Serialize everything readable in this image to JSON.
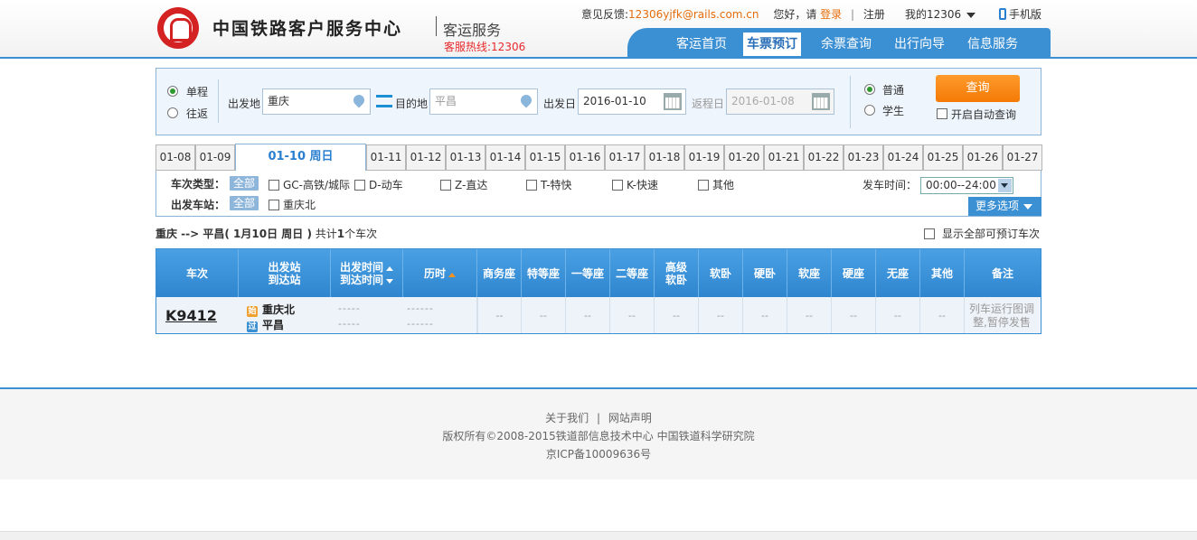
{
  "header": {
    "site_title": "中国铁路客户服务中心",
    "site_subtitle": "客运服务",
    "hotline": "客服热线:12306",
    "feedback_label": "意见反馈:",
    "feedback_email": "12306yjfk@rails.com.cn",
    "greeting": "您好，请",
    "login": "登录",
    "sep": "|",
    "register": "注册",
    "my12306": "我的12306",
    "mobile": "手机版"
  },
  "nav": [
    {
      "label": "客运首页",
      "active": false
    },
    {
      "label": "车票预订",
      "active": true
    },
    {
      "label": "余票查询",
      "active": false
    },
    {
      "label": "出行向导",
      "active": false
    },
    {
      "label": "信息服务",
      "active": false
    }
  ],
  "search": {
    "trip_single": "单程",
    "trip_round": "往返",
    "from_label": "出发地",
    "from_value": "重庆",
    "to_label": "目的地",
    "to_placeholder": "平昌",
    "depart_label": "出发日",
    "depart_value": "2016-01-10",
    "return_label": "返程日",
    "return_value": "2016-01-08",
    "ticket_normal": "普通",
    "ticket_student": "学生",
    "query_button": "查询",
    "auto_query": "开启自动查询"
  },
  "date_tabs": [
    "01-08",
    "01-09",
    "01-10 周日",
    "01-11",
    "01-12",
    "01-13",
    "01-14",
    "01-15",
    "01-16",
    "01-17",
    "01-18",
    "01-19",
    "01-20",
    "01-21",
    "01-22",
    "01-23",
    "01-24",
    "01-25",
    "01-26",
    "01-27"
  ],
  "active_date_index": 2,
  "filters": {
    "train_type_label": "车次类型：",
    "station_label": "出发车站：",
    "all": "全部",
    "types": [
      "GC-高铁/城际",
      "D-动车",
      "Z-直达",
      "T-特快",
      "K-快速",
      "其他"
    ],
    "stations": [
      "重庆北"
    ],
    "depart_time_label": "发车时间：",
    "depart_time_value": "00:00--24:00",
    "more_options": "更多选项"
  },
  "summary": {
    "route": "重庆 --> 平昌",
    "date": "( 1月10日  周日 )",
    "total_prefix": "共计",
    "total_count": "1",
    "total_suffix": "个车次",
    "show_all": "显示全部可预订车次"
  },
  "table": {
    "headers": {
      "train": "车次",
      "stations_1": "出发站",
      "stations_2": "到达站",
      "times_1": "出发时间",
      "times_2": "到达时间",
      "duration": "历时",
      "business": "商务座",
      "special": "特等座",
      "first": "一等座",
      "second": "二等座",
      "soft_sleeper_adv_1": "高级",
      "soft_sleeper_adv_2": "软卧",
      "soft_sleeper": "软卧",
      "hard_sleeper": "硬卧",
      "soft_seat": "软座",
      "hard_seat": "硬座",
      "no_seat": "无座",
      "other": "其他",
      "note": "备注"
    },
    "rows": [
      {
        "train_no": "K9412",
        "from_badge": "始",
        "from_station": "重庆北",
        "to_badge": "过",
        "to_station": "平昌",
        "depart_time": "-----",
        "arrive_time": "-----",
        "duration_1": "------",
        "duration_2": "------",
        "seat": "--",
        "note": "列车运行图调整,暂停发售"
      }
    ]
  },
  "footer": {
    "about": "关于我们",
    "sep": "|",
    "statement": "网站声明",
    "copyright": "版权所有©2008-2015铁道部信息技术中心  中国铁道科学研究院",
    "icp": "京ICP备10009636号"
  },
  "colors": {
    "brand_blue": "#3b8fd3",
    "accent_orange": "#f47a05",
    "logo_red": "#d42121"
  }
}
